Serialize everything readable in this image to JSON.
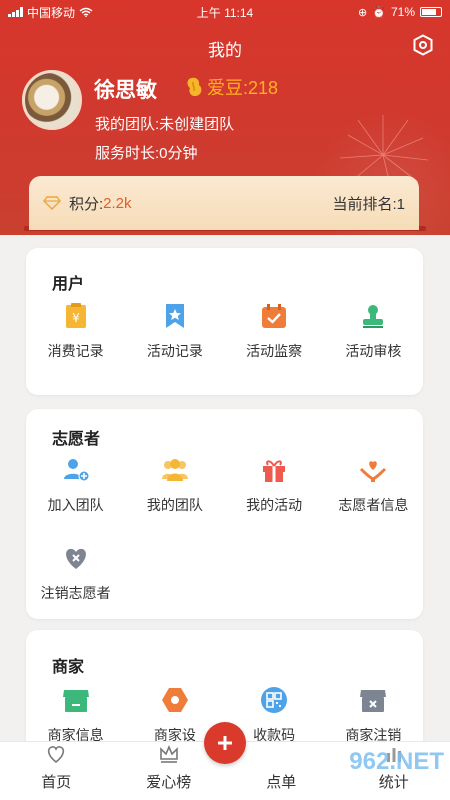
{
  "status_bar": {
    "carrier": "中国移动",
    "time": "上午 11:14",
    "battery": "71%"
  },
  "header": {
    "title": "我的"
  },
  "profile": {
    "name": "徐思敏",
    "beans_label": "爱豆:218",
    "team": "我的团队:未创建团队",
    "service_time": "服务时长:0分钟"
  },
  "points": {
    "label": "积分:",
    "value": "2.2k",
    "rank": "当前排名:1"
  },
  "sections": {
    "user": {
      "title": "用户",
      "items": [
        {
          "label": "消费记录",
          "icon": "receipt-yen-icon",
          "color": "#f5b635"
        },
        {
          "label": "活动记录",
          "icon": "bookmark-star-icon",
          "color": "#4ea3e8"
        },
        {
          "label": "活动监察",
          "icon": "calendar-check-icon",
          "color": "#f07c3a"
        },
        {
          "label": "活动审核",
          "icon": "stamp-icon",
          "color": "#3cb87a"
        }
      ]
    },
    "volunteer": {
      "title": "志愿者",
      "items": [
        {
          "label": "加入团队",
          "icon": "add-user-icon",
          "color": "#4ea3e8"
        },
        {
          "label": "我的团队",
          "icon": "group-icon",
          "color": "#f5b635"
        },
        {
          "label": "我的活动",
          "icon": "gift-icon",
          "color": "#ef5a4f"
        },
        {
          "label": "志愿者信息",
          "icon": "heart-hand-icon",
          "color": "#f07c3a"
        },
        {
          "label": "注销志愿者",
          "icon": "heart-x-icon",
          "color": "#7d8593"
        }
      ]
    },
    "merchant": {
      "title": "商家",
      "items": [
        {
          "label": "商家信息",
          "icon": "store-icon",
          "color": "#3cb87a"
        },
        {
          "label": "商家设",
          "icon": "hexagon-icon",
          "color": "#f07c3a"
        },
        {
          "label": "收款码",
          "icon": "qr-code-icon",
          "color": "#4ea3e8"
        },
        {
          "label": "商家注销",
          "icon": "store-x-icon",
          "color": "#7d8593"
        }
      ]
    }
  },
  "bottom_nav": [
    {
      "label": "首页",
      "icon": "heart-outline-icon"
    },
    {
      "label": "爱心榜",
      "icon": "crown-icon"
    },
    {
      "label": "点单",
      "icon": "plus-icon"
    },
    {
      "label": "统计",
      "icon": "stats-icon"
    }
  ],
  "watermark": "962.NET"
}
